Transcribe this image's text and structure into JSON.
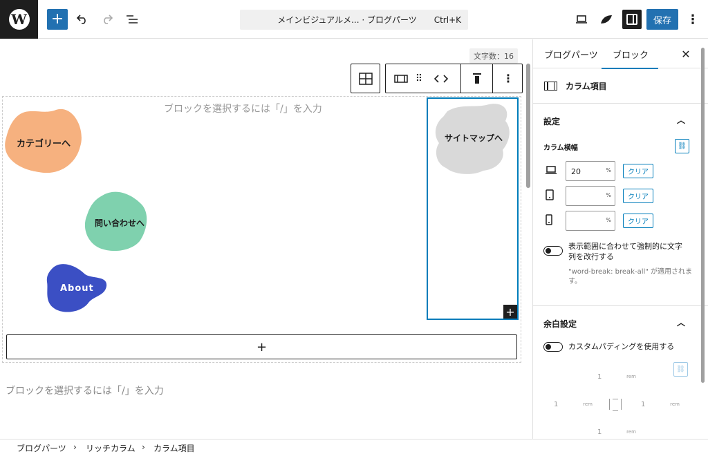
{
  "topbar": {
    "add_icon": "plus-icon",
    "undo_icon": "undo-icon",
    "redo_icon": "redo-icon",
    "listview_icon": "list-view-icon",
    "doc_title": "メインビジュアルメ... · ブログパーツ",
    "doc_shortcut": "Ctrl+K",
    "preview_icon": "laptop-icon",
    "plugin_icon": "brand-icon",
    "save_label": "保存",
    "options_icon": "more-vertical-icon"
  },
  "canvas": {
    "word_count": "文字数：16",
    "placeholder_top": "ブロックを選択するには「/」を入力",
    "placeholder_bottom": "ブロックを選択するには「/」を入力",
    "blobs": [
      {
        "label": "カテゴリーへ",
        "color": "#f6b17f"
      },
      {
        "label": "問い合わせへ",
        "color": "#7fd1ae"
      },
      {
        "label": "About",
        "color": "#3b4fc4"
      },
      {
        "label": "サイトマップへ",
        "color": "#d9d9d9"
      }
    ],
    "appender_label": "+",
    "column_appender_label": "+"
  },
  "sidebar": {
    "tabs": [
      {
        "label": "ブログパーツ"
      },
      {
        "label": "ブロック"
      }
    ],
    "block_name": "カラム項目",
    "settings": {
      "heading": "設定",
      "width_label": "カラム横幅",
      "rows": [
        {
          "device_icon": "laptop-icon",
          "value": "20",
          "unit": "%",
          "clear": "クリア"
        },
        {
          "device_icon": "tablet-icon",
          "value": "",
          "unit": "%",
          "clear": "クリア"
        },
        {
          "device_icon": "mobile-icon",
          "value": "",
          "unit": "%",
          "clear": "クリア"
        }
      ],
      "toggle_label": "表示範囲に合わせて強制的に文字列を改行する",
      "help": "\"word-break: break-all\" が適用されます。"
    },
    "padding": {
      "heading": "余白設定",
      "toggle_label": "カスタムパディングを使用する",
      "top": {
        "value": "1",
        "unit": "rem"
      },
      "left": {
        "value": "1",
        "unit": "rem"
      },
      "right": {
        "value": "1",
        "unit": "rem"
      },
      "bottom": {
        "value": "1",
        "unit": "rem"
      }
    }
  },
  "footer": {
    "breadcrumbs": [
      "ブログパーツ",
      "リッチカラム",
      "カラム項目"
    ]
  },
  "colors": {
    "accent": "#2271b1",
    "selection": "#007cba"
  }
}
